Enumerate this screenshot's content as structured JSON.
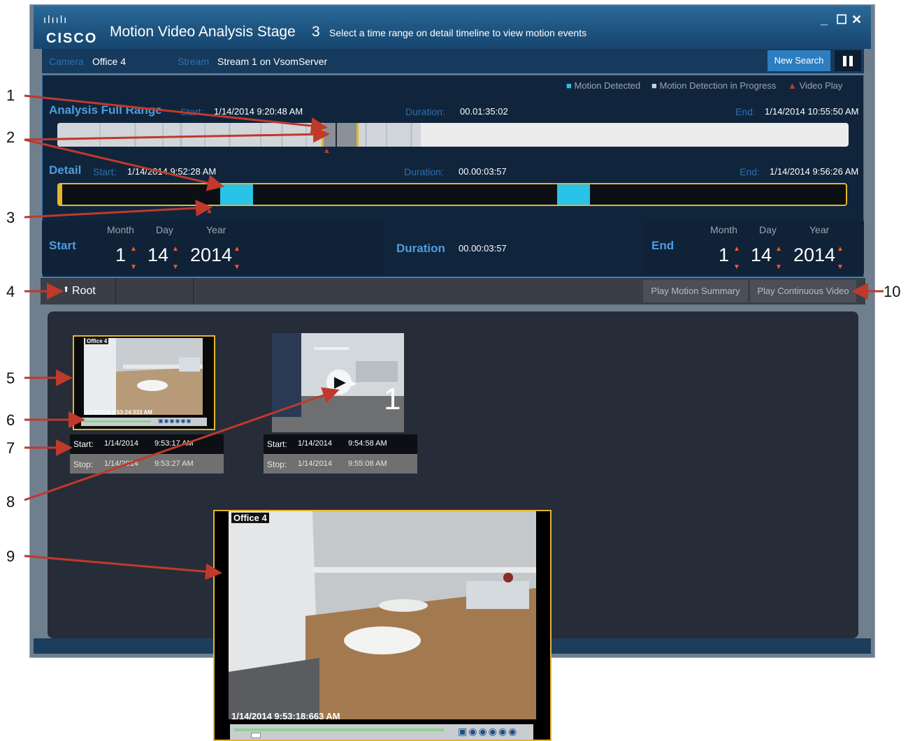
{
  "window": {
    "logo_bars": "ılıılı",
    "logo_text": "CISCO",
    "title": "Motion Video Analysis Stage",
    "stage": "3",
    "hint": "Select a time range on detail timeline to view motion events",
    "controls": {
      "minimize": "_",
      "maximize": "☐",
      "close": "✕"
    }
  },
  "camera_row": {
    "camera_label": "Camera",
    "camera_value": "Office 4",
    "stream_label": "Stream",
    "stream_value": "Stream 1 on VsomServer",
    "new_search": "New Search"
  },
  "legend": {
    "motion_detected": "Motion Detected",
    "in_progress": "Motion Detection in Progress",
    "video_play": "Video Play",
    "colors": {
      "motion": "#29c2e8",
      "progress": "#9aa5b0",
      "video_play": "#c0392b"
    }
  },
  "analysis": {
    "label": "Analysis Full Range",
    "start_label": "Start:",
    "start_value": "1/14/2014 9:20:48 AM",
    "duration_label": "Duration:",
    "duration_value": "00.01:35:02",
    "end_label": "End:",
    "end_value": "1/14/2014 10:55:50 AM"
  },
  "detail": {
    "label": "Detail",
    "start_label": "Start:",
    "start_value": "1/14/2014 9:52:28 AM",
    "duration_label": "Duration:",
    "duration_value": "00.00:03:57",
    "end_label": "End:",
    "end_value": "1/14/2014 9:56:26 AM"
  },
  "date_panel": {
    "start_label": "Start",
    "end_label": "End",
    "duration_label": "Duration",
    "duration_value": "00.00:03:57",
    "month_label": "Month",
    "day_label": "Day",
    "year_label": "Year",
    "start": {
      "month": "1",
      "day": "14",
      "year": "2014"
    },
    "end": {
      "month": "1",
      "day": "14",
      "year": "2014"
    }
  },
  "nav": {
    "root": "Root",
    "play_summary": "Play Motion Summary",
    "play_continuous": "Play Continuous Video"
  },
  "thumbnails": [
    {
      "camera": "Office 4",
      "timestamp": "1/14/2014 9:53:24:333 AM",
      "start_label": "Start:",
      "start_date": "1/14/2014",
      "start_time": "9:53:17 AM",
      "stop_label": "Stop:",
      "stop_date": "1/14/2014",
      "stop_time": "9:53:27 AM"
    },
    {
      "index": "1",
      "start_label": "Start:",
      "start_date": "1/14/2014",
      "start_time": "9:54:58 AM",
      "stop_label": "Stop:",
      "stop_date": "1/14/2014",
      "stop_time": "9:55:08 AM"
    }
  ],
  "large_player": {
    "camera": "Office 4",
    "timestamp": "1/14/2014 9:53:18:663 AM"
  },
  "callouts": [
    "1",
    "2",
    "3",
    "4",
    "5",
    "6",
    "7",
    "8",
    "9",
    "10"
  ]
}
